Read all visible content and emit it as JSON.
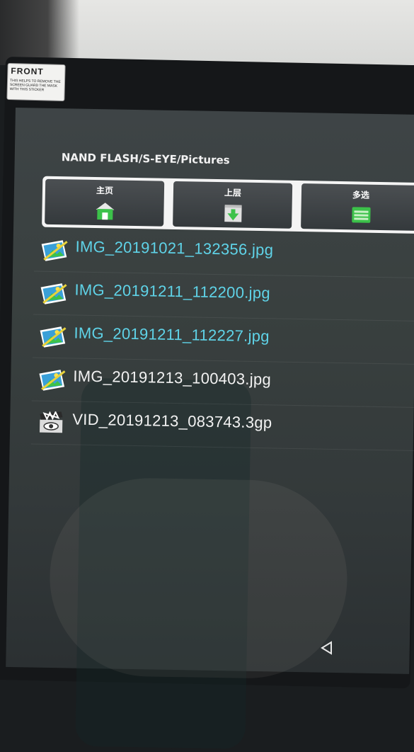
{
  "device": {
    "sticker_title": "FRONT",
    "sticker_text": "THIS HELPS TO REMOVE THE SCREEN GUARD THE MASK WITH THIS STICKER"
  },
  "header": {
    "path": "NAND FLASH/S-EYE/Pictures"
  },
  "toolbar": {
    "home_label": "主页",
    "up_label": "上层",
    "multiselect_label": "多选"
  },
  "files": [
    {
      "name": "IMG_20191021_132356.jpg",
      "type": "image",
      "color": "#5fd3e8"
    },
    {
      "name": "IMG_20191211_112200.jpg",
      "type": "image",
      "color": "#5fd3e8"
    },
    {
      "name": "IMG_20191211_112227.jpg",
      "type": "image",
      "color": "#5fd3e8"
    },
    {
      "name": "IMG_20191213_100403.jpg",
      "type": "image",
      "color": "#f2f2f2"
    },
    {
      "name": "VID_20191213_083743.3gp",
      "type": "video",
      "color": "#f2f2f2"
    }
  ],
  "navbar": {
    "back_icon": "back-triangle-icon"
  }
}
